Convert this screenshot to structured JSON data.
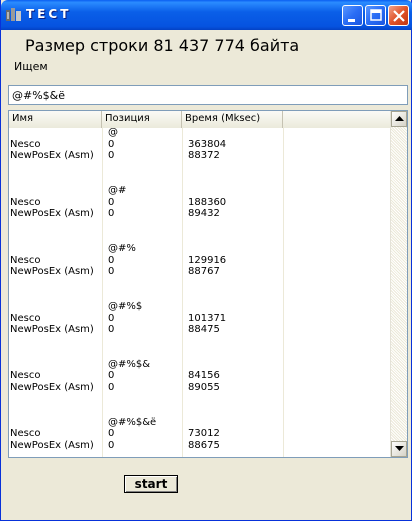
{
  "window": {
    "title": "ТЕСТ",
    "icon": "app-icon"
  },
  "title_buttons": {
    "minimize": "minimize-icon",
    "maximize": "maximize-icon",
    "close": "close-icon"
  },
  "heading": "Размер строки 81 437 774 байта",
  "search": {
    "label": "Ищем",
    "value": "@#%$&ё"
  },
  "table": {
    "columns": [
      "Имя",
      "Позиция",
      "Время (Mksec)",
      ""
    ],
    "rows": [
      [
        "",
        "@",
        "",
        ""
      ],
      [
        "Nesco",
        "0",
        "363804",
        ""
      ],
      [
        "NewPosEx (Asm)",
        "0",
        "88372",
        ""
      ],
      [
        "",
        "",
        "",
        ""
      ],
      [
        "",
        "",
        "",
        ""
      ],
      [
        "",
        "@#",
        "",
        ""
      ],
      [
        "Nesco",
        "0",
        "188360",
        ""
      ],
      [
        "NewPosEx (Asm)",
        "0",
        "89432",
        ""
      ],
      [
        "",
        "",
        "",
        ""
      ],
      [
        "",
        "",
        "",
        ""
      ],
      [
        "",
        "@#%",
        "",
        ""
      ],
      [
        "Nesco",
        "0",
        "129916",
        ""
      ],
      [
        "NewPosEx (Asm)",
        "0",
        "88767",
        ""
      ],
      [
        "",
        "",
        "",
        ""
      ],
      [
        "",
        "",
        "",
        ""
      ],
      [
        "",
        "@#%$",
        "",
        ""
      ],
      [
        "Nesco",
        "0",
        "101371",
        ""
      ],
      [
        "NewPosEx (Asm)",
        "0",
        "88475",
        ""
      ],
      [
        "",
        "",
        "",
        ""
      ],
      [
        "",
        "",
        "",
        ""
      ],
      [
        "",
        "@#%$&",
        "",
        ""
      ],
      [
        "Nesco",
        "0",
        "84156",
        ""
      ],
      [
        "NewPosEx (Asm)",
        "0",
        "89055",
        ""
      ],
      [
        "",
        "",
        "",
        ""
      ],
      [
        "",
        "",
        "",
        ""
      ],
      [
        "",
        "@#%$&ё",
        "",
        ""
      ],
      [
        "Nesco",
        "0",
        "73012",
        ""
      ],
      [
        "NewPosEx (Asm)",
        "0",
        "88675",
        ""
      ]
    ]
  },
  "scrollbar": {
    "up": "scroll-up-arrow-icon",
    "down": "scroll-down-arrow-icon"
  },
  "start_button": "start"
}
